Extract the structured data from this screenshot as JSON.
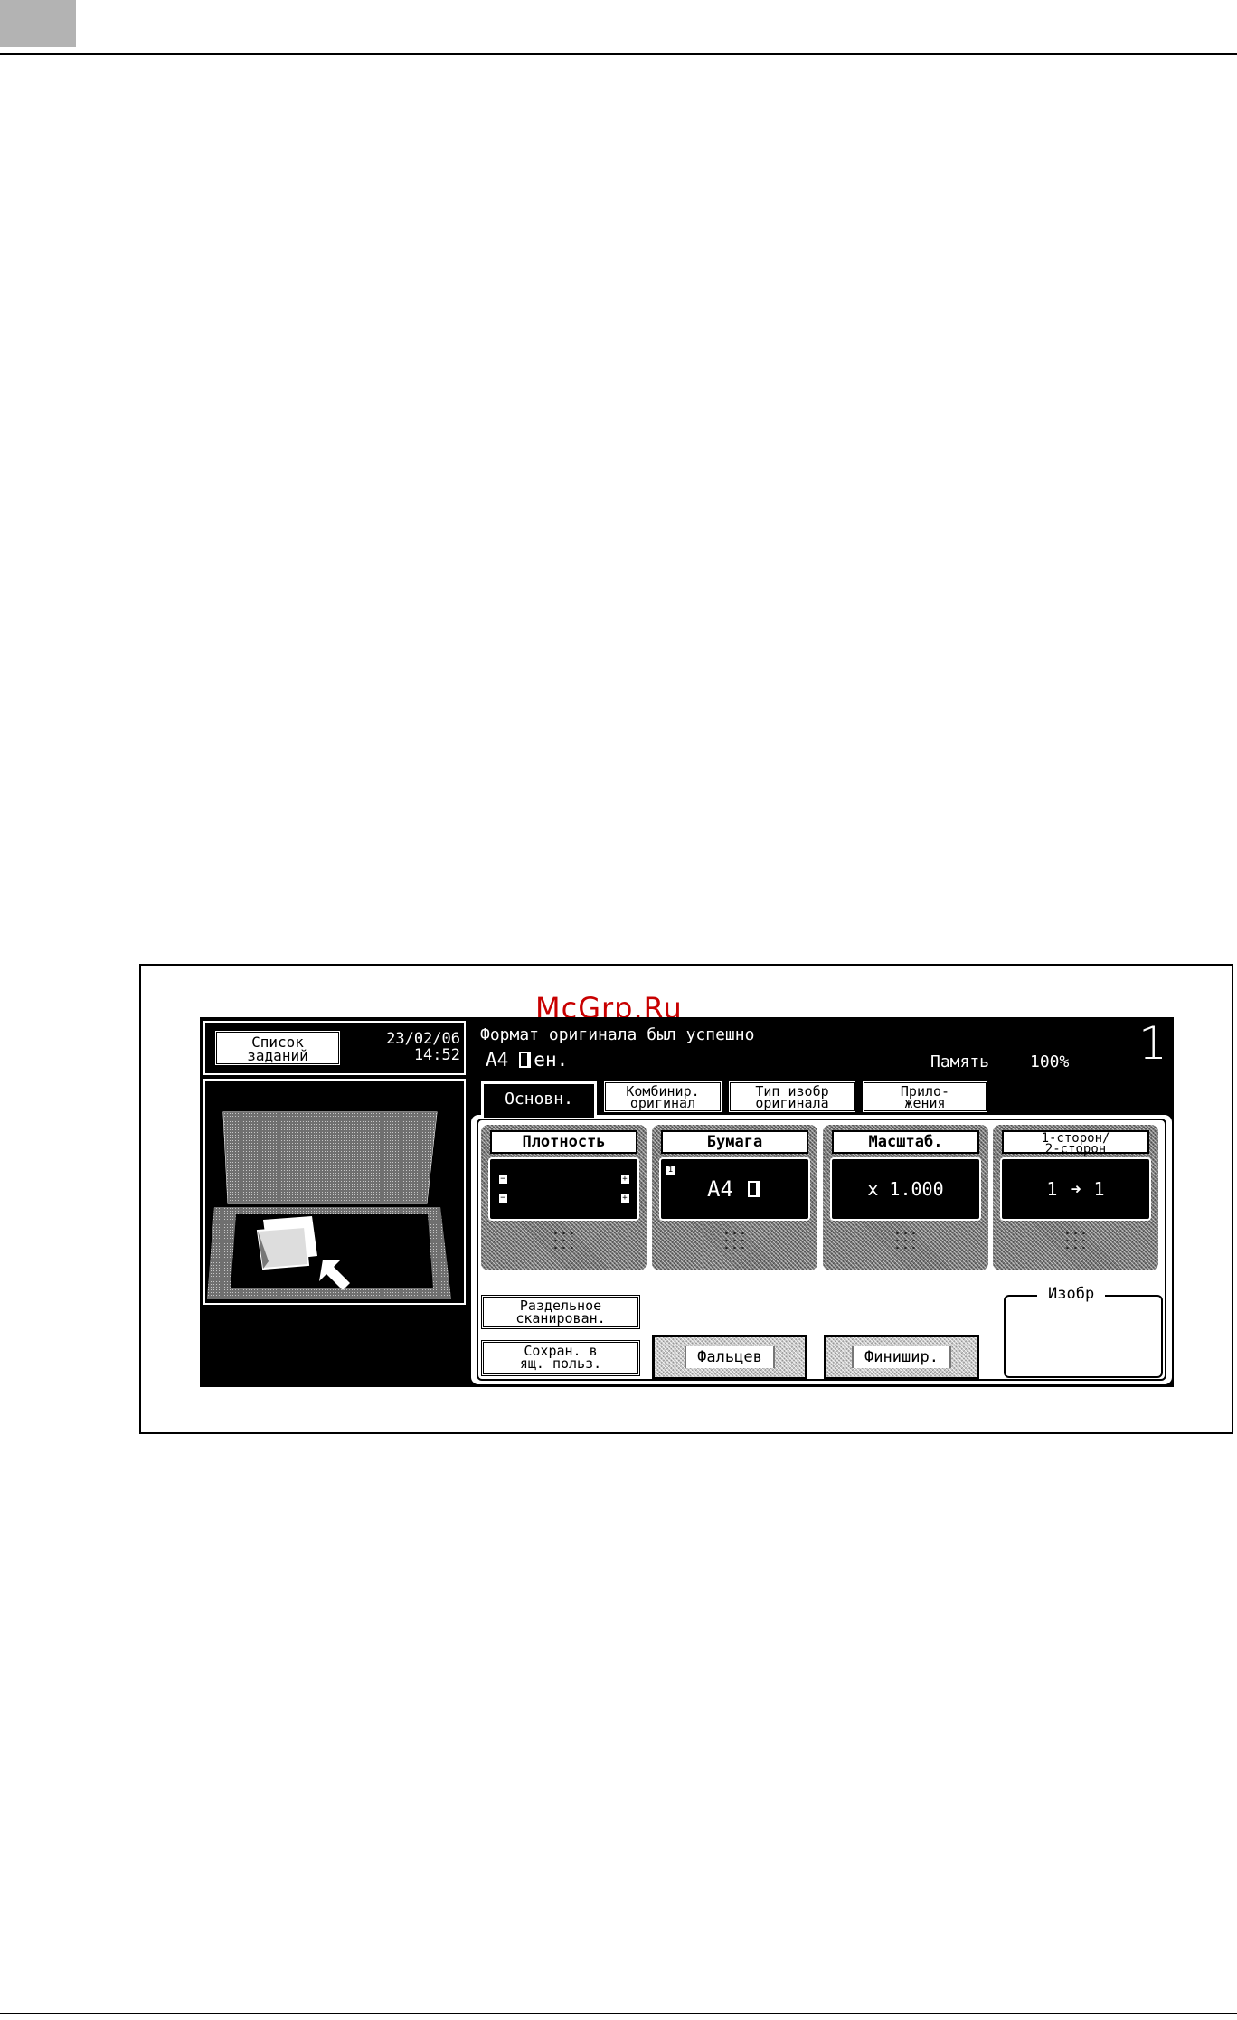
{
  "watermark": "McGrp.Ru",
  "panel": {
    "job_list_button": "Список\nзаданий",
    "datetime": "23/02/06\n14:52",
    "message_line1": "Формат оригинала был успешно",
    "message_size": "A4",
    "message_suffix": "ен.",
    "memory_label": "Память",
    "memory_value": "100%",
    "copies": "1",
    "tabs": [
      {
        "label": "Основн.",
        "active": true
      },
      {
        "label": "Комбинир.\nоригинал",
        "active": false
      },
      {
        "label": "Тип изобр\nоригинала",
        "active": false
      },
      {
        "label": "Прило-\nжения",
        "active": false
      }
    ],
    "cards": {
      "density": {
        "label": "Плотность"
      },
      "paper": {
        "label": "Бумага",
        "tray": "1",
        "value": "A4"
      },
      "zoom": {
        "label": "Масштаб.",
        "value": "x 1.000"
      },
      "duplex": {
        "label": "1-сторон/\n2-сторон",
        "value_from": "1",
        "value_to": "1"
      }
    },
    "buttons": {
      "separate_scan": "Раздельное\nсканирован.",
      "save_box": "Сохран. в\nящ. польз.",
      "fold": "Фальцев",
      "finish": "Финишир."
    },
    "image_box_label": "Изобр"
  }
}
